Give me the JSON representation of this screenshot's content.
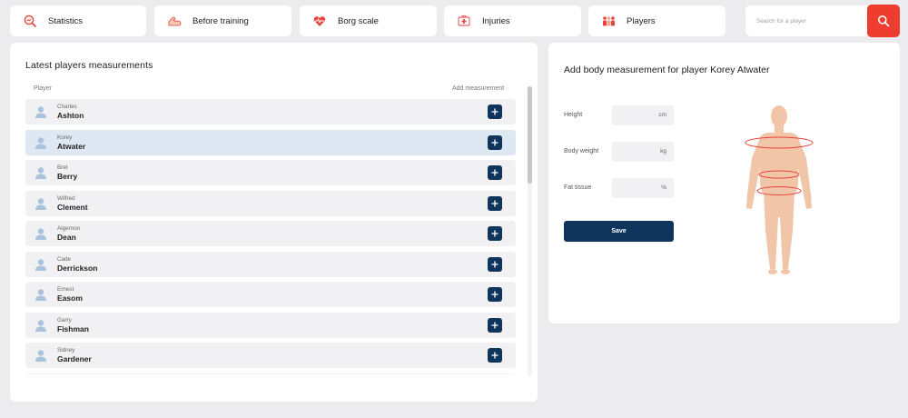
{
  "nav": [
    {
      "label": "Statistics",
      "icon": "chart-search-icon"
    },
    {
      "label": "Before training",
      "icon": "arm-muscle-icon"
    },
    {
      "label": "Borg scale",
      "icon": "heart-rate-icon"
    },
    {
      "label": "Injuries",
      "icon": "first-aid-icon"
    },
    {
      "label": "Players",
      "icon": "team-icon"
    }
  ],
  "search": {
    "placeholder": "Search for a player",
    "icon": "search-icon"
  },
  "left": {
    "title": "Latest players measurements",
    "col_player": "Player",
    "col_add": "Add measurement",
    "rows": [
      {
        "first": "Charles",
        "last": "Ashton"
      },
      {
        "first": "Korey",
        "last": "Atwater",
        "selected": true
      },
      {
        "first": "Bret",
        "last": "Berry"
      },
      {
        "first": "Wilfred",
        "last": "Clement"
      },
      {
        "first": "Algernon",
        "last": "Dean"
      },
      {
        "first": "Cade",
        "last": "Derrickson"
      },
      {
        "first": "Ernest",
        "last": "Easom"
      },
      {
        "first": "Garry",
        "last": "Fishman"
      },
      {
        "first": "Sidney",
        "last": "Gardener"
      },
      {
        "first": "",
        "last": ""
      }
    ]
  },
  "right": {
    "title": "Add body measurement for player Korey Atwater",
    "height_label": "Height",
    "height_unit": "cm",
    "weight_label": "Body weight",
    "weight_unit": "kg",
    "fat_label": "Fat tissue",
    "fat_unit": "%",
    "save_label": "Save"
  },
  "colors": {
    "accent_red": "#ee3d2e",
    "navy": "#10355d",
    "selected_row": "#dde8f2",
    "skin": "#f0c5a8"
  }
}
